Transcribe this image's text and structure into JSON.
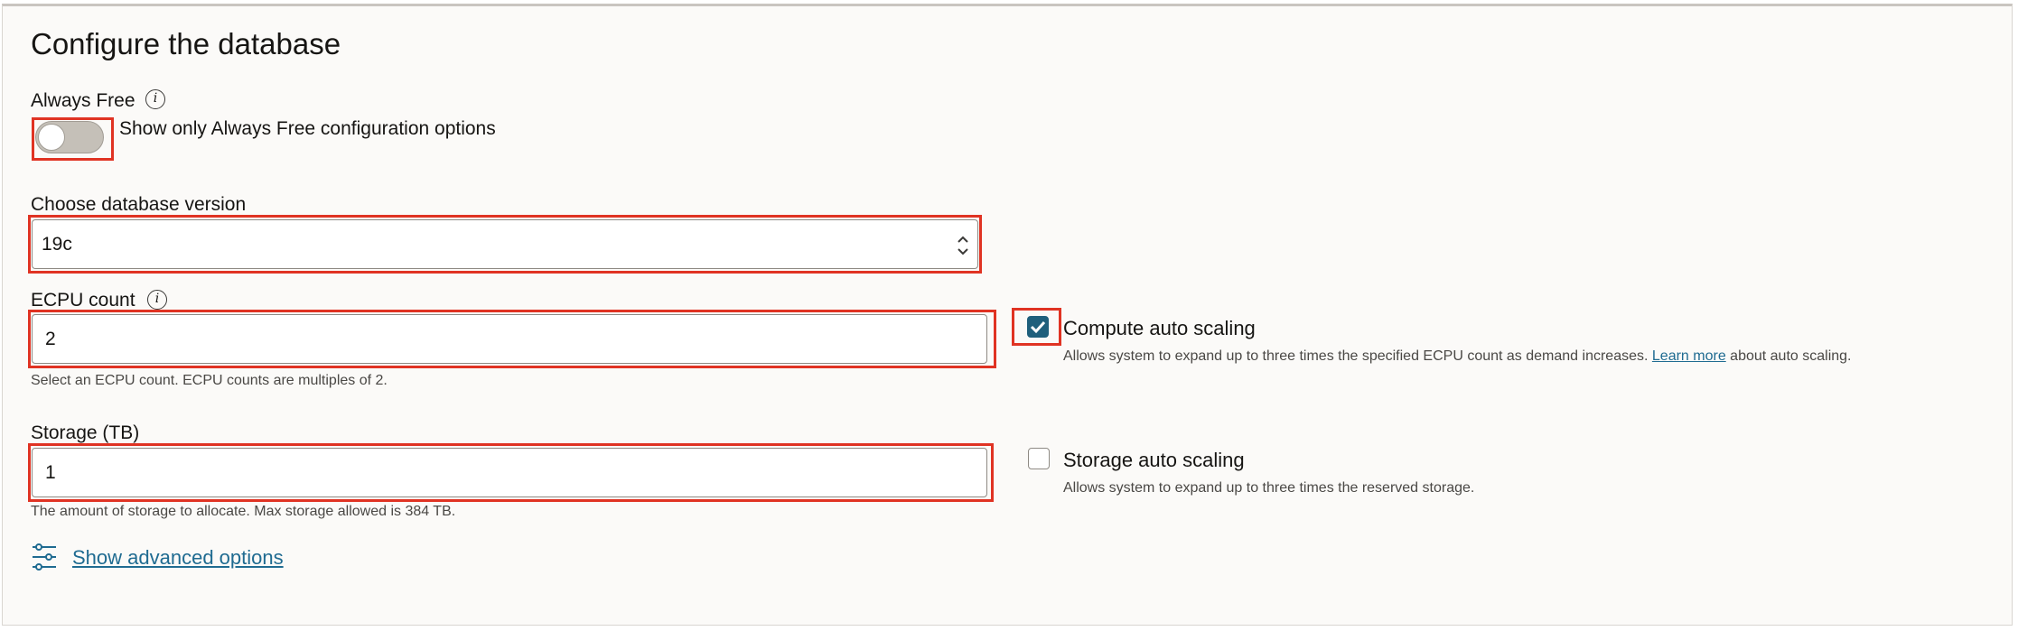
{
  "section": {
    "title": "Configure the database"
  },
  "always_free": {
    "label": "Always Free",
    "info_icon": "info-icon",
    "toggle_label": "Show only Always Free configuration options",
    "toggle_on": false
  },
  "db_version": {
    "label": "Choose database version",
    "value": "19c"
  },
  "ecpu": {
    "label": "ECPU count",
    "info_icon": "info-icon",
    "value": "2",
    "helper": "Select an ECPU count. ECPU counts are multiples of 2."
  },
  "compute_scaling": {
    "label": "Compute auto scaling",
    "checked": true,
    "desc_before": "Allows system to expand up to three times the specified ECPU count as demand increases.",
    "link": "Learn more",
    "desc_after": "about auto scaling."
  },
  "storage": {
    "label": "Storage (TB)",
    "value": "1",
    "helper": "The amount of storage to allocate. Max storage allowed is 384 TB."
  },
  "storage_scaling": {
    "label": "Storage auto scaling",
    "checked": false,
    "desc": "Allows system to expand up to three times the reserved storage."
  },
  "advanced": {
    "link": "Show advanced options",
    "icon": "sliders-icon"
  },
  "colors": {
    "highlight": "#e03323",
    "accent": "#1f5f7c",
    "link": "#1f6b91"
  }
}
